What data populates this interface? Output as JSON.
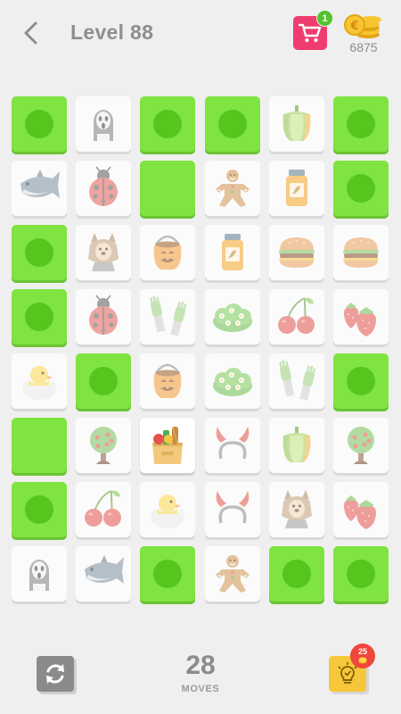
{
  "header": {
    "back_icon": "chevron-left-icon",
    "level_title": "Level 88",
    "cart_icon": "shopping-cart-icon",
    "cart_badge": "1",
    "coins_icon": "coins-icon",
    "coin_count": "6875"
  },
  "board": {
    "columns": 6,
    "rows": 8,
    "cells": [
      [
        "cleared",
        "ghost",
        "cleared",
        "cleared",
        "pepper",
        "cleared"
      ],
      [
        "fish",
        "ladybug",
        "cleared-empty",
        "gingerbread",
        "jam-jar",
        "cleared"
      ],
      [
        "cleared",
        "werewolf",
        "pumpkin-bucket",
        "jam-jar",
        "burger",
        "burger"
      ],
      [
        "cleared",
        "ladybug",
        "zombie-hands",
        "bush",
        "cherries",
        "strawberries"
      ],
      [
        "chick",
        "cleared",
        "pumpkin-bucket",
        "bush",
        "zombie-hands",
        "cleared"
      ],
      [
        "cleared-empty",
        "tree",
        "grocery-bag",
        "devil-horns",
        "pepper",
        "tree"
      ],
      [
        "cleared",
        "cherries",
        "chick",
        "devil-horns",
        "werewolf",
        "strawberries"
      ],
      [
        "ghost",
        "fish",
        "cleared",
        "gingerbread",
        "cleared",
        "cleared"
      ]
    ],
    "selected": [
      5,
      2
    ]
  },
  "footer": {
    "restart_icon": "restart-icon",
    "moves_value": "28",
    "moves_label": "MOVES",
    "hint_icon": "lightbulb-hint-icon",
    "hint_badge_count": "25"
  },
  "colors": {
    "background": "#efefef",
    "cleared_tile": "#7fe341",
    "cleared_dot": "#55c61d",
    "cart_button": "#ef3d6f",
    "hint_button": "#f6c73a",
    "hint_badge": "#f0463b",
    "cart_badge": "#55c32d"
  }
}
